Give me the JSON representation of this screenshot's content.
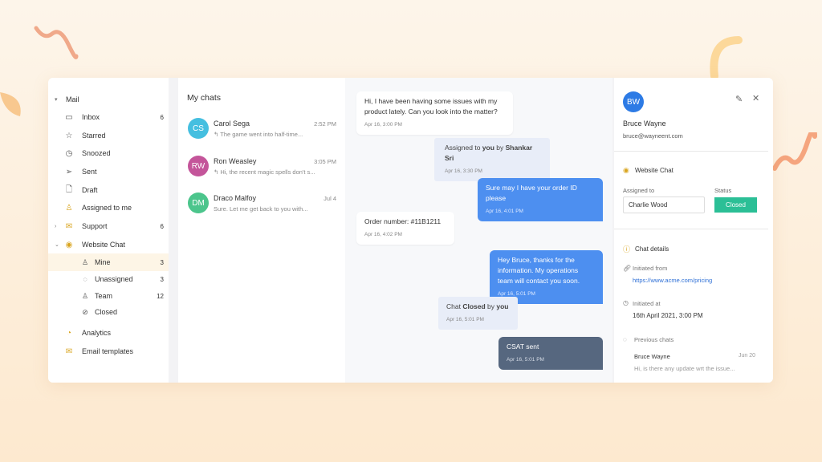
{
  "sidebar": {
    "section": "Mail",
    "items": [
      {
        "label": "Inbox",
        "count": "6",
        "icon": "inbox-icon"
      },
      {
        "label": "Starred",
        "count": "",
        "icon": "star-icon"
      },
      {
        "label": "Snoozed",
        "count": "",
        "icon": "clock-icon"
      },
      {
        "label": "Sent",
        "count": "",
        "icon": "send-icon"
      },
      {
        "label": "Draft",
        "count": "",
        "icon": "file-icon"
      },
      {
        "label": "Assigned to me",
        "count": "",
        "icon": "user-icon"
      },
      {
        "label": "Support",
        "count": "6",
        "icon": "inbox-tray-icon"
      },
      {
        "label": "Website Chat",
        "count": "",
        "icon": "chat-icon"
      }
    ],
    "sub_items": [
      {
        "label": "Mine",
        "count": "3"
      },
      {
        "label": "Unassigned",
        "count": "3"
      },
      {
        "label": "Team",
        "count": "12"
      },
      {
        "label": "Closed",
        "count": ""
      }
    ],
    "bottom": [
      {
        "label": "Analytics"
      },
      {
        "label": "Email templates"
      }
    ]
  },
  "list": {
    "title": "My chats",
    "chats": [
      {
        "initials": "CS",
        "name": "Carol Sega",
        "time": "2:52 PM",
        "preview": "The game went into half-time...",
        "color": "#45bfe0"
      },
      {
        "initials": "RW",
        "name": "Ron Weasley",
        "time": "3:05 PM",
        "preview": "Hi, the recent magic spells don't s...",
        "color": "#c4559a"
      },
      {
        "initials": "DM",
        "name": "Draco Malfoy",
        "time": "Jul 4",
        "preview": "Sure. Let me get back to you with...",
        "color": "#4cc58c"
      }
    ]
  },
  "conversation": {
    "m1": {
      "text": "Hi, I have been having some issues with my product lately. Can you look into the matter?",
      "time": "Apr 16, 3:00 PM"
    },
    "m2": {
      "a": "Assigned to ",
      "b": "you",
      "c": " by ",
      "d": "Shankar Sri",
      "time": "Apr 16, 3:30 PM"
    },
    "m3": {
      "text": "Sure may I have your order ID please",
      "time": "Apr 16, 4:01 PM"
    },
    "m4": {
      "text": "Order number: #11B1211",
      "time": "Apr 16, 4:02 PM"
    },
    "m5": {
      "text": "Hey Bruce, thanks for the information. My operations team will contact you soon.",
      "time": "Apr 16, 5:01 PM"
    },
    "m6": {
      "a": "Chat ",
      "b": "Closed",
      "c": " by ",
      "d": "you",
      "time": "Apr 16, 5:01 PM"
    },
    "m7": {
      "text": "CSAT sent",
      "time": "Apr 16, 5:01 PM"
    }
  },
  "details": {
    "initials": "BW",
    "name": "Bruce Wayne",
    "email": "bruce@wayneent.com",
    "channel": "Website Chat",
    "assigned_label": "Assigned to",
    "assigned_value": "Charlie Wood",
    "status_label": "Status",
    "status_value": "Closed",
    "status_color": "#2bbf96",
    "chat_details": "Chat details",
    "initiated_from_label": "Initiated from",
    "initiated_from": "https://www.acme.com/pricing",
    "initiated_at_label": "Initiated at",
    "initiated_at": "16th April 2021, 3:00 PM",
    "previous_label": "Previous chats",
    "previous": {
      "name": "Bruce Wayne",
      "date": "Jun 20",
      "preview": "Hi, is there any update wrt the issue..."
    }
  }
}
